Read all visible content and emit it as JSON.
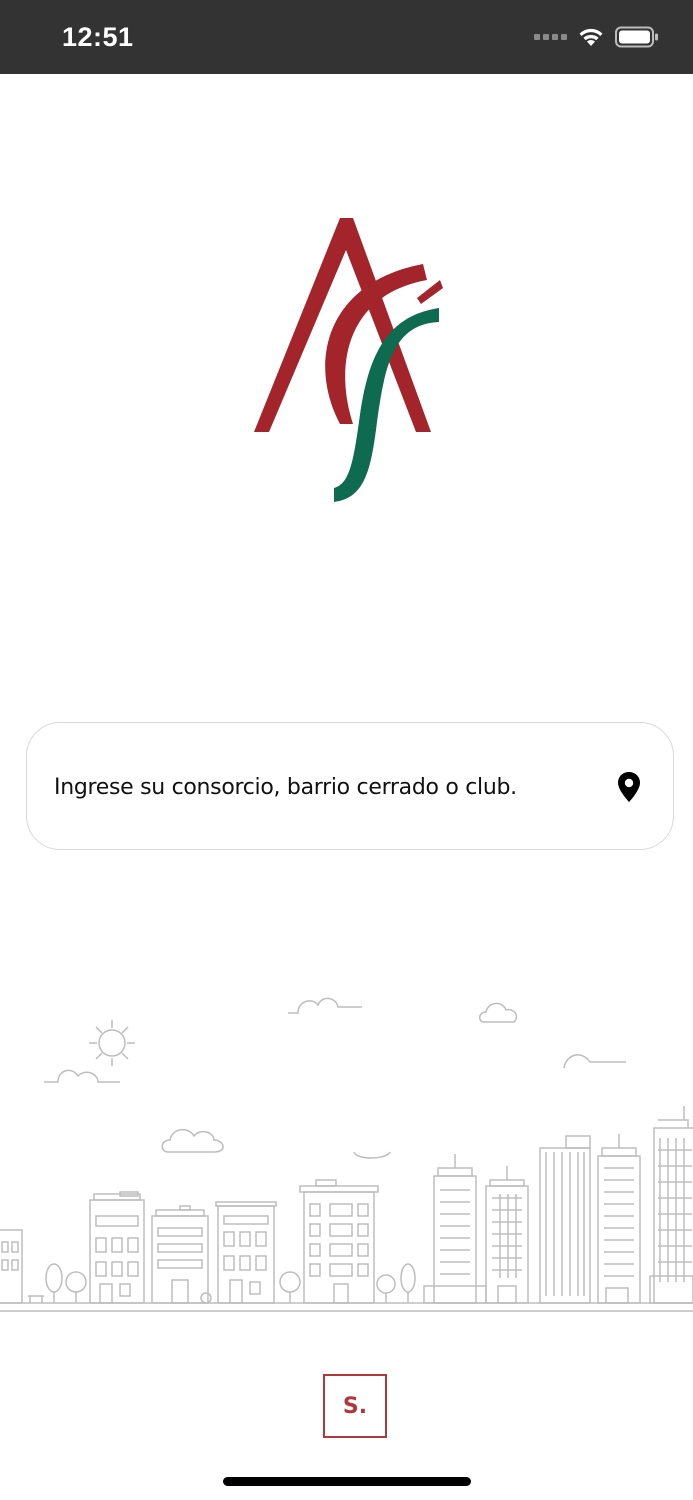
{
  "status_bar": {
    "time": "12:51"
  },
  "logo": {
    "colors": {
      "red": "#a3242a",
      "green": "#0e6b50"
    }
  },
  "search": {
    "placeholder": "Ingrese su consorcio, barrio cerrado o club.",
    "icon": "location-pin-icon"
  },
  "footer": {
    "brand_badge": "S.",
    "brand_color": "#b0383d"
  },
  "illustration": {
    "name": "city-skyline-illustration",
    "stroke_color": "#bdbdbd"
  }
}
